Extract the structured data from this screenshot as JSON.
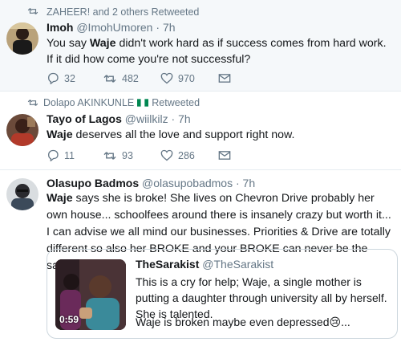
{
  "tweets": [
    {
      "retweet_line": "ZAHEER! and 2 others Retweeted",
      "name": "Imoh",
      "handle": "@ImohUmoren",
      "separator": "·",
      "time": "7h",
      "body_bold": "Waje",
      "body_pre": "You say ",
      "body_post": " didn't work hard as if success comes from hard work. If it did how come you're not successful?",
      "replies": "32",
      "retweets": "482",
      "likes": "970"
    },
    {
      "retweet_line_name": "Dolapo AKINKUNLE",
      "retweet_line_suffix": "Retweeted",
      "name": "Tayo of Lagos",
      "handle": "@wiilkilz",
      "separator": "·",
      "time": "7h",
      "body_bold": "Waje",
      "body_post": " deserves all the love and support right now.",
      "replies": "11",
      "retweets": "93",
      "likes": "286"
    },
    {
      "name": "Olasupo Badmos",
      "handle": "@olasupobadmos",
      "separator": "·",
      "time": "7h",
      "body_bold": "Waje",
      "body_post": " says she is broke! She lives on Chevron Drive probably her own house... schoolfees around there is insanely crazy but worth it... I can advise we all mind our businesses. Priorities & Drive are totally different so also her BROKE and your BROKE can never be the same BROKE",
      "quote": {
        "name": "TheSarakist",
        "handle": "@TheSarakist",
        "body": "This is a cry for help; Waje, a single mother is putting a daughter through university all by herself. She is talented.",
        "body2": "Waje is broken maybe even depressed😢...",
        "duration": "0:59"
      }
    }
  ],
  "colors": {
    "muted": "#657786",
    "text": "#14171a",
    "highlight_bg": "#f5f8fa",
    "border": "#e6ecf0"
  }
}
